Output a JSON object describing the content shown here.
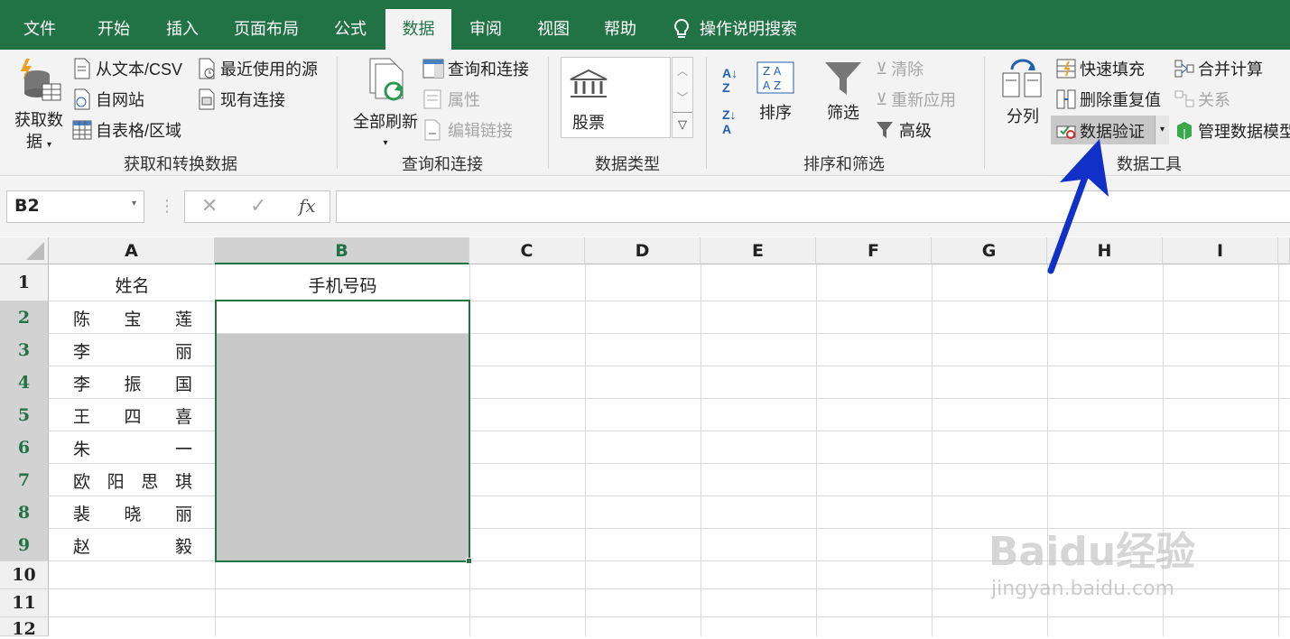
{
  "tabs": [
    "文件",
    "开始",
    "插入",
    "页面布局",
    "公式",
    "数据",
    "审阅",
    "视图",
    "帮助"
  ],
  "tell_me": "操作说明搜索",
  "ribbon": {
    "get_data": {
      "label_line1": "获取数",
      "label_line2": "据"
    },
    "from_text_csv": "从文本/CSV",
    "from_web": "自网站",
    "from_table": "自表格/区域",
    "recent_sources": "最近使用的源",
    "existing_connections": "现有连接",
    "group_get_transform": "获取和转换数据",
    "refresh_all": "全部刷新",
    "queries_connections": "查询和连接",
    "properties": "属性",
    "edit_links": "编辑链接",
    "group_queries": "查询和连接",
    "stocks": "股票",
    "group_data_types": "数据类型",
    "sort": "排序",
    "filter": "筛选",
    "clear": "清除",
    "reapply": "重新应用",
    "advanced": "高级",
    "group_sort_filter": "排序和筛选",
    "text_to_columns": "分列",
    "flash_fill": "快速填充",
    "remove_duplicates": "删除重复值",
    "data_validation": "数据验证",
    "consolidate": "合并计算",
    "relationships": "关系",
    "manage_data_model": "管理数据模型",
    "group_data_tools": "数据工具"
  },
  "formula_bar": {
    "name_box": "B2",
    "fx": "fx",
    "cancel": "✕",
    "enter": "✓"
  },
  "columns": [
    "A",
    "B",
    "C",
    "D",
    "E",
    "F",
    "G",
    "H",
    "I"
  ],
  "rows": [
    "1",
    "2",
    "3",
    "4",
    "5",
    "6",
    "7",
    "8",
    "9",
    "10",
    "11",
    "12"
  ],
  "sheet": {
    "header_a": "姓名",
    "header_b": "手机号码",
    "names": [
      [
        "陈",
        "宝",
        "莲"
      ],
      [
        "李",
        "",
        "丽"
      ],
      [
        "李",
        "振",
        "国"
      ],
      [
        "王",
        "四",
        "喜"
      ],
      [
        "朱",
        "",
        "一"
      ],
      [
        "欧",
        "阳",
        "思",
        "琪"
      ],
      [
        "裴",
        "晓",
        "丽"
      ],
      [
        "赵",
        "",
        "毅"
      ]
    ]
  },
  "watermark": {
    "text": "Baidu经验",
    "url": "jingyan.baidu.com"
  },
  "colors": {
    "excel_green": "#217346",
    "selection_gray": "#c8c8c8",
    "arrow_blue": "#1030c8"
  }
}
